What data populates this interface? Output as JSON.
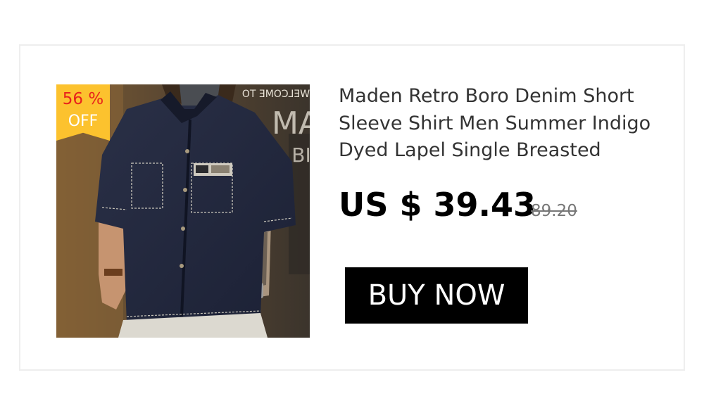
{
  "product": {
    "title": "Maden Retro Boro Denim Short Sleeve Shirt Men Summer Indigo Dyed Lapel Single Breasted",
    "price": "US $ 39.43",
    "original_price": "89.20",
    "discount": {
      "percent": "56 %",
      "label": "OFF"
    },
    "image_sign_text": "WELCOME TO",
    "buy_label": "BUY NOW"
  },
  "colors": {
    "badge": "#fcc22e",
    "badge_percent": "#e8221b",
    "button": "#000000",
    "button_text": "#ffffff"
  }
}
